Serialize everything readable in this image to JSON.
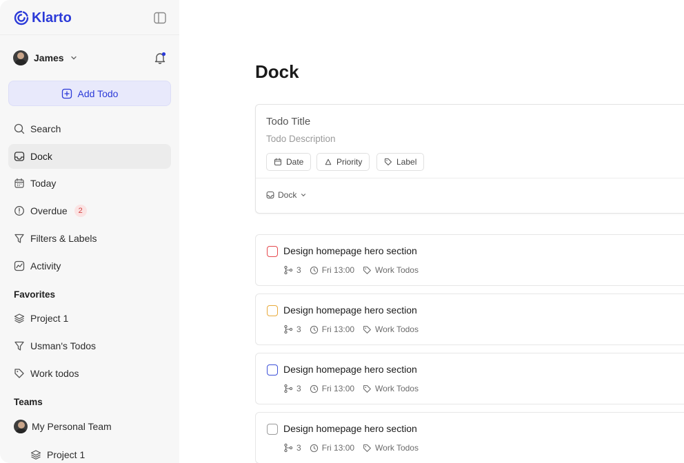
{
  "app": {
    "brand": "Klarto"
  },
  "user": {
    "name": "James"
  },
  "sidebar": {
    "add_todo": "Add Todo",
    "nav": [
      {
        "label": "Search",
        "icon": "search-icon"
      },
      {
        "label": "Dock",
        "icon": "inbox-icon",
        "active": true
      },
      {
        "label": "Today",
        "icon": "calendar-icon"
      },
      {
        "label": "Overdue",
        "icon": "alert-circle-icon",
        "badge": "2"
      },
      {
        "label": "Filters & Labels",
        "icon": "filter-icon"
      },
      {
        "label": "Activity",
        "icon": "activity-icon"
      }
    ],
    "favorites_title": "Favorites",
    "favorites": [
      {
        "label": "Project 1",
        "icon": "layers-icon"
      },
      {
        "label": "Usman's Todos",
        "icon": "filter-icon"
      },
      {
        "label": "Work todos",
        "icon": "tag-icon"
      }
    ],
    "teams_title": "Teams",
    "teams": [
      {
        "label": "My Personal Team",
        "icon": "avatar"
      },
      {
        "label": "Project 1",
        "icon": "layers-icon"
      }
    ]
  },
  "main": {
    "title": "Dock",
    "composer": {
      "title_placeholder": "Todo Title",
      "description_placeholder": "Todo Description",
      "chips": [
        "Date",
        "Priority",
        "Label"
      ],
      "project_select": "Dock"
    },
    "tasks": [
      {
        "title": "Design homepage hero section",
        "subtasks": "3",
        "due": "Fri 13:00",
        "label": "Work Todos",
        "priority_color": "#e5484d"
      },
      {
        "title": "Design homepage hero section",
        "subtasks": "3",
        "due": "Fri 13:00",
        "label": "Work Todos",
        "priority_color": "#e8a93a"
      },
      {
        "title": "Design homepage hero section",
        "subtasks": "3",
        "due": "Fri 13:00",
        "label": "Work Todos",
        "priority_color": "#3b4fd8"
      },
      {
        "title": "Design homepage hero section",
        "subtasks": "3",
        "due": "Fri 13:00",
        "label": "Work Todos",
        "priority_color": "#9a9a9a"
      }
    ]
  },
  "colors": {
    "accent": "#2b3ad8",
    "sidebar_bg": "#f7f7f7",
    "active_bg": "#ececec"
  }
}
